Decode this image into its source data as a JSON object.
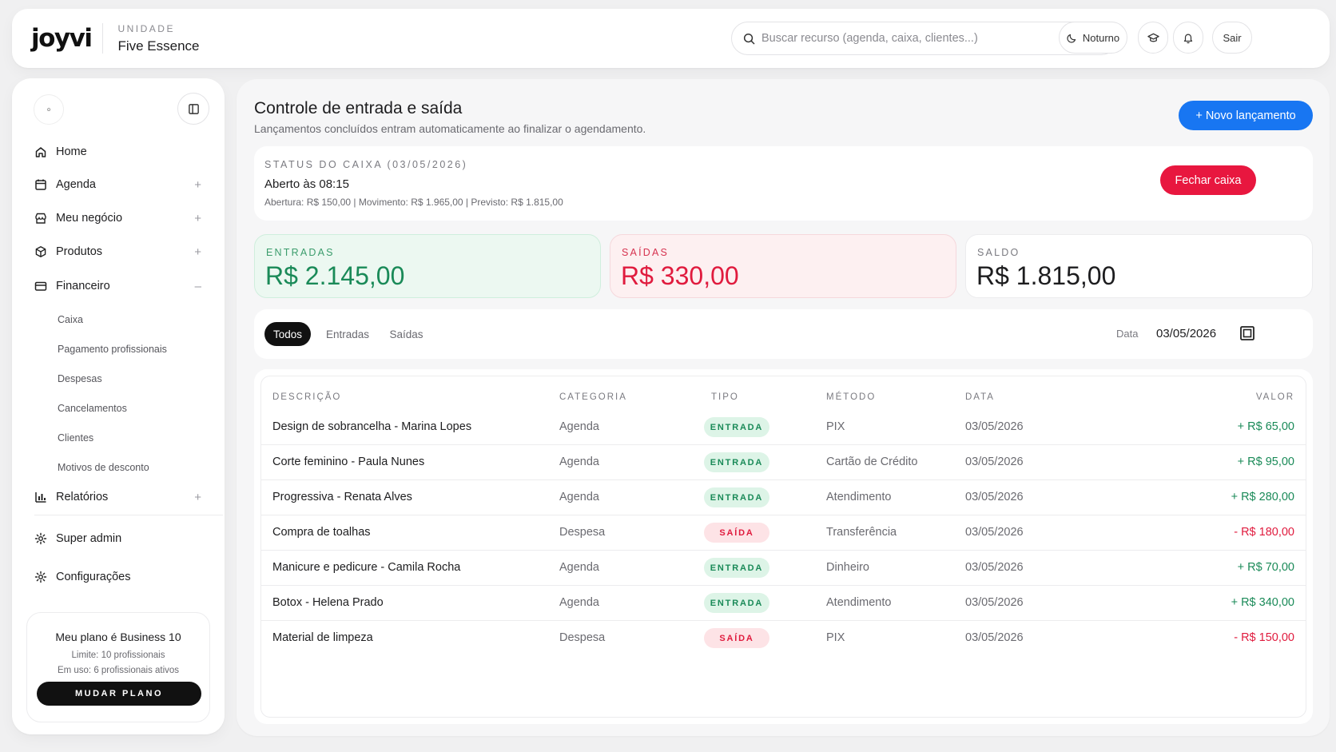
{
  "header": {
    "logo": "joyvi",
    "unit_label": "UNIDADE",
    "unit_name": "Five Essence",
    "search_placeholder": "Buscar recurso (agenda, caixa, clientes...)",
    "theme_button": "Noturno",
    "logout_button": "Sair"
  },
  "sidebar": {
    "items": [
      {
        "label": "Home",
        "icon": "home-icon"
      },
      {
        "label": "Agenda",
        "icon": "calendar-icon",
        "toggle": "+"
      },
      {
        "label": "Meu negócio",
        "icon": "store-icon",
        "toggle": "+"
      },
      {
        "label": "Produtos",
        "icon": "box-icon",
        "toggle": "+"
      },
      {
        "label": "Financeiro",
        "icon": "wallet-icon",
        "toggle": "–"
      }
    ],
    "financeiro_sub": [
      "Caixa",
      "Pagamento profissionais",
      "Despesas",
      "Cancelamentos",
      "Clientes",
      "Motivos de desconto"
    ],
    "relatorios": {
      "label": "Relatórios",
      "toggle": "+"
    },
    "super_admin": "Super admin",
    "configuracoes": "Configurações",
    "plan": {
      "title": "Meu plano é Business 10",
      "limit": "Limite: 10 profissionais",
      "usage": "Em uso: 6 profissionais ativos",
      "button": "MUDAR PLANO"
    }
  },
  "main": {
    "title": "Controle de entrada e saída",
    "subtitle": "Lançamentos concluídos entram automaticamente ao finalizar o agendamento.",
    "new_button": "+ Novo lançamento",
    "status": {
      "label": "STATUS DO CAIXA (03/05/2026)",
      "opened": "Aberto às 08:15",
      "detail": "Abertura: R$ 150,00 | Movimento: R$ 1.965,00 | Previsto: R$ 1.815,00",
      "close_button": "Fechar caixa"
    },
    "stats": {
      "entradas_label": "ENTRADAS",
      "entradas_value": "R$ 2.145,00",
      "saidas_label": "SAÍDAS",
      "saidas_value": "R$ 330,00",
      "saldo_label": "SALDO",
      "saldo_value": "R$ 1.815,00"
    },
    "filters": {
      "tabs": [
        "Todos",
        "Entradas",
        "Saídas"
      ],
      "active_tab": "Todos",
      "date_label": "Data",
      "date_value": "03/05/2026"
    },
    "table": {
      "headers": [
        "DESCRIÇÃO",
        "CATEGORIA",
        "TIPO",
        "MÉTODO",
        "DATA",
        "VALOR"
      ],
      "rows": [
        {
          "desc": "Design de sobrancelha - Marina Lopes",
          "cat": "Agenda",
          "tipo": "ENTRADA",
          "metodo": "PIX",
          "data": "03/05/2026",
          "valor": "+ R$ 65,00"
        },
        {
          "desc": "Corte feminino - Paula Nunes",
          "cat": "Agenda",
          "tipo": "ENTRADA",
          "metodo": "Cartão de Crédito",
          "data": "03/05/2026",
          "valor": "+ R$ 95,00"
        },
        {
          "desc": "Progressiva - Renata Alves",
          "cat": "Agenda",
          "tipo": "ENTRADA",
          "metodo": "Atendimento",
          "data": "03/05/2026",
          "valor": "+ R$ 280,00"
        },
        {
          "desc": "Compra de toalhas",
          "cat": "Despesa",
          "tipo": "SAÍDA",
          "metodo": "Transferência",
          "data": "03/05/2026",
          "valor": "- R$ 180,00"
        },
        {
          "desc": "Manicure e pedicure - Camila Rocha",
          "cat": "Agenda",
          "tipo": "ENTRADA",
          "metodo": "Dinheiro",
          "data": "03/05/2026",
          "valor": "+ R$ 70,00"
        },
        {
          "desc": "Botox - Helena Prado",
          "cat": "Agenda",
          "tipo": "ENTRADA",
          "metodo": "Atendimento",
          "data": "03/05/2026",
          "valor": "+ R$ 340,00"
        },
        {
          "desc": "Material de limpeza",
          "cat": "Despesa",
          "tipo": "SAÍDA",
          "metodo": "PIX",
          "data": "03/05/2026",
          "valor": "- R$ 150,00"
        }
      ]
    }
  },
  "colors": {
    "accent": "#1876f2",
    "danger": "#e01b3e",
    "success": "#1a8a58"
  }
}
